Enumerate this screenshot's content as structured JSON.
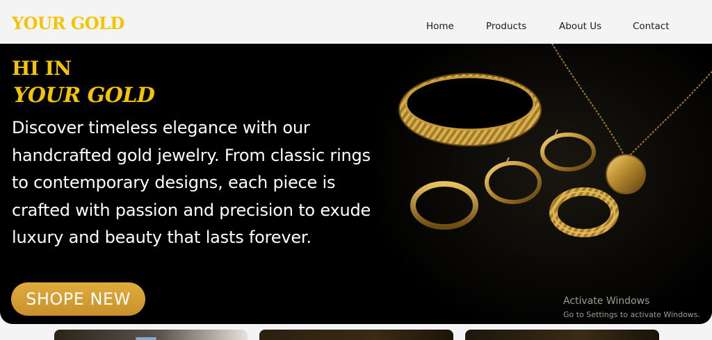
{
  "header": {
    "brand": "YOUR GOLD",
    "nav": [
      "Home",
      "Products",
      "About Us",
      "Contact"
    ]
  },
  "hero": {
    "title_line1": "HI IN",
    "title_line2": "YOUR GOLD",
    "description": "Discover timeless elegance with our handcrafted gold jewelry. From classic rings to contemporary designs, each piece is crafted with passion and precision to exude luxury and beauty that lasts forever.",
    "button": "SHOPE NEW",
    "image_subject": "gold bracelet, rings, hoop earrings and pendant necklace"
  },
  "watermark": {
    "line1": "Activate Windows",
    "line2": "Go to Settings to activate Windows."
  },
  "colors": {
    "brand": "#f5c400",
    "button": "#d49e33",
    "hero_bg": "#000000",
    "header_bg": "#f4f4f4"
  }
}
